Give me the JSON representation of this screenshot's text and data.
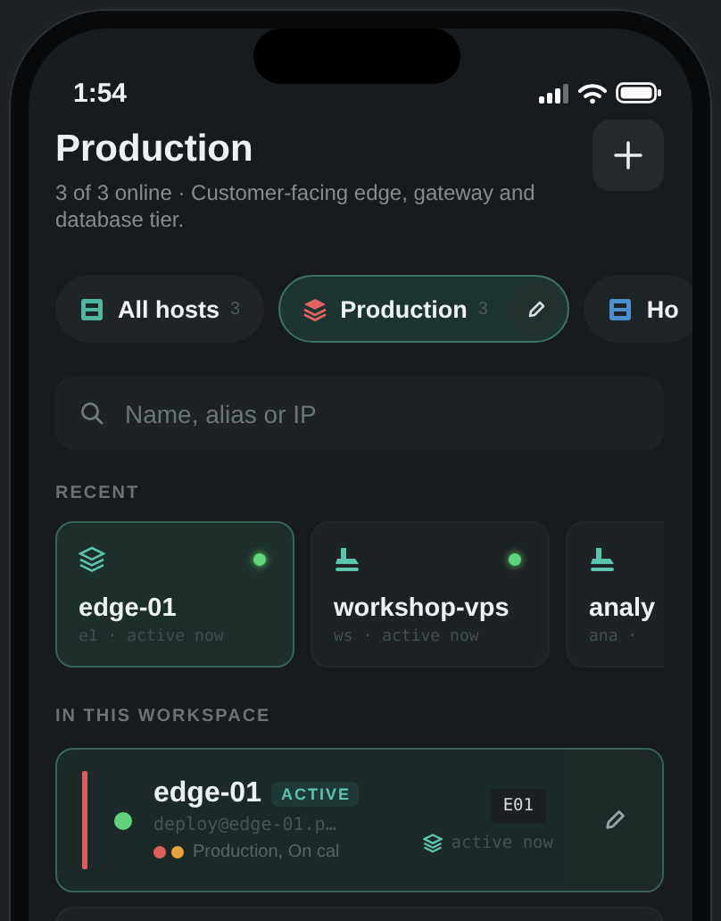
{
  "status_bar": {
    "time": "1:54"
  },
  "header": {
    "title": "Production",
    "subtitle": "3 of 3 online · Customer-facing edge, gateway and database tier."
  },
  "tabs": [
    {
      "label": "All hosts",
      "count": "3",
      "kind": "server",
      "color": "#4fb7a0",
      "selected": false,
      "editable": false
    },
    {
      "label": "Production",
      "count": "3",
      "kind": "stack",
      "color": "#e06464",
      "selected": true,
      "editable": true
    },
    {
      "label": "Ho",
      "kind": "server",
      "color": "#4a8fd0",
      "selected": false,
      "editable": false
    }
  ],
  "search": {
    "placeholder": "Name, alias or IP"
  },
  "recent": {
    "title": "RECENT",
    "items": [
      {
        "name": "edge-01",
        "meta": "e1 · active now",
        "kind": "stack",
        "online": true,
        "selected": true
      },
      {
        "name": "workshop-vps",
        "meta": "ws · active now",
        "kind": "ship",
        "online": true,
        "selected": false
      },
      {
        "name": "analy",
        "meta": "ana ·",
        "kind": "ship",
        "selected": false
      }
    ]
  },
  "workspace": {
    "title": "IN THIS WORKSPACE",
    "hosts": [
      {
        "name": "edge-01",
        "badge": "ACTIVE",
        "address": "deploy@edge-01.p…",
        "color": "#e05d5d",
        "online": true,
        "tag_dots": [
          {
            "color": "#e05d5d"
          },
          {
            "color": "#e8a23c"
          }
        ],
        "tags": "Production, On cal",
        "code": "E01",
        "activity": "active now",
        "selected": true
      }
    ]
  }
}
